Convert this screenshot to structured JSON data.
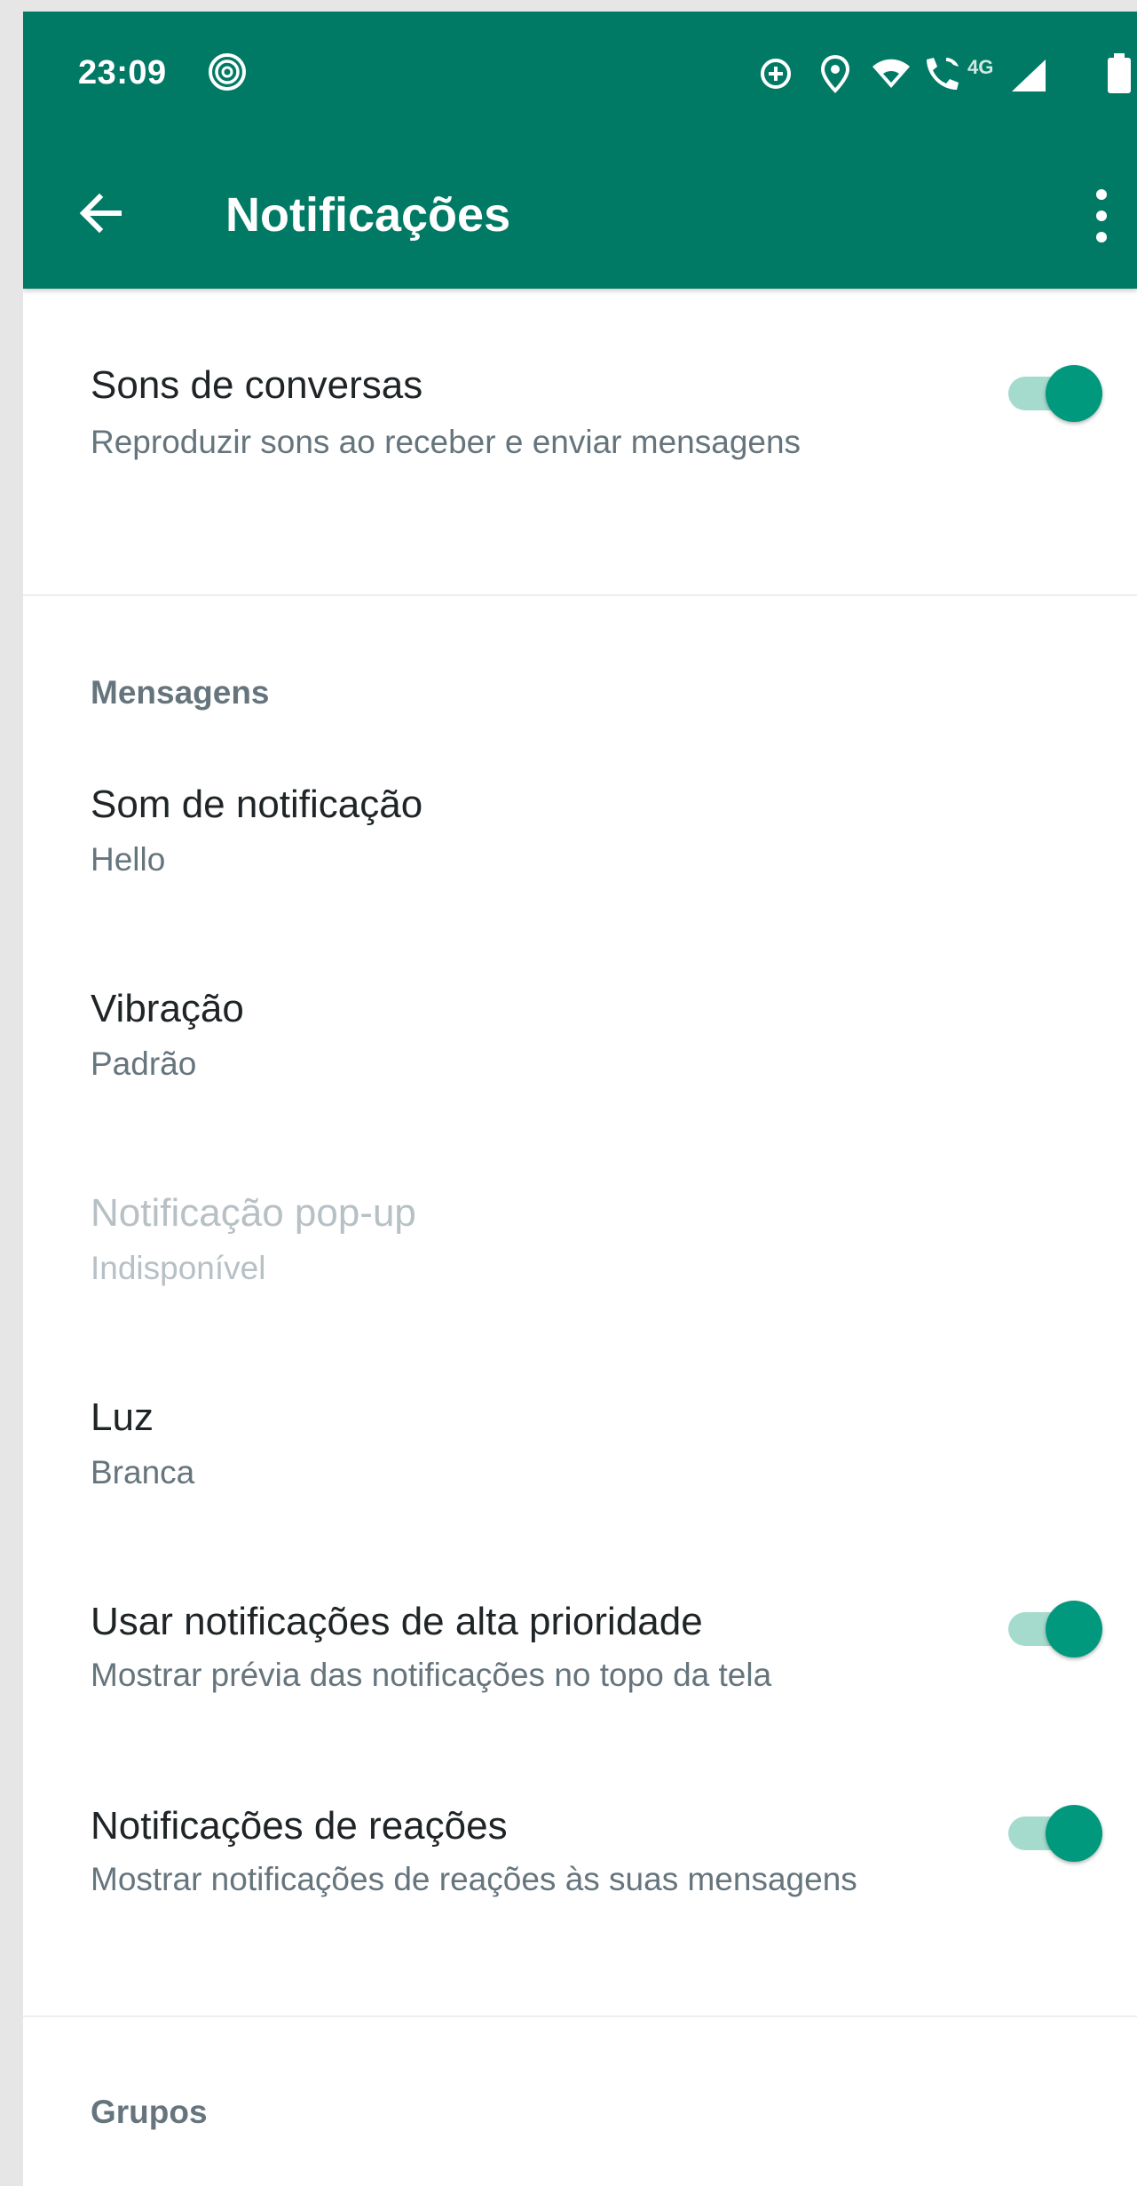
{
  "status_bar": {
    "time": "23:09",
    "network_label": "4G"
  },
  "toolbar": {
    "title": "Notificações"
  },
  "colors": {
    "app_bar": "#017a65",
    "toggle_on": "#00997d",
    "toggle_track": "#a4dbcc"
  },
  "settings": {
    "chat_sounds": {
      "title": "Sons de conversas",
      "subtitle": "Reproduzir sons ao receber e enviar mensagens",
      "enabled": true
    },
    "messages_section": "Mensagens",
    "notification_tone": {
      "title": "Som de notificação",
      "value": "Hello"
    },
    "vibrate": {
      "title": "Vibração",
      "value": "Padrão"
    },
    "popup": {
      "title": "Notificação pop-up",
      "value": "Indisponível"
    },
    "light": {
      "title": "Luz",
      "value": "Branca"
    },
    "high_priority": {
      "title": "Usar notificações de alta prioridade",
      "subtitle": "Mostrar prévia das notificações no topo da tela",
      "enabled": true
    },
    "reactions": {
      "title": "Notificações de reações",
      "subtitle": "Mostrar notificações de reações às suas mensagens",
      "enabled": true
    },
    "groups_section": "Grupos"
  }
}
